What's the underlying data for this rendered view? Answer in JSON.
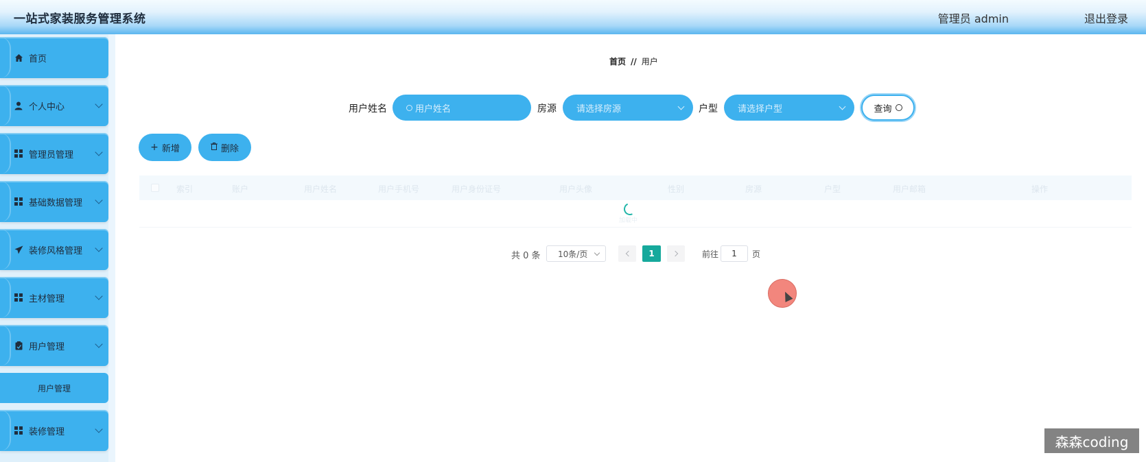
{
  "header": {
    "title": "一站式家装服务管理系统",
    "user": "管理员 admin",
    "logout": "退出登录"
  },
  "sidebar": {
    "items": [
      {
        "label": "首页",
        "icon": "home-icon"
      },
      {
        "label": "个人中心",
        "icon": "user-icon"
      },
      {
        "label": "管理员管理",
        "icon": "grid-icon"
      },
      {
        "label": "基础数据管理",
        "icon": "grid-icon"
      },
      {
        "label": "装修风格管理",
        "icon": "send-icon"
      },
      {
        "label": "主材管理",
        "icon": "grid-icon"
      },
      {
        "label": "用户管理",
        "icon": "clipboard-icon"
      },
      {
        "label": "装修管理",
        "icon": "grid-icon"
      }
    ],
    "submenu": {
      "label": "用户管理"
    }
  },
  "breadcrumb": {
    "home": "首页",
    "sep": "//",
    "current": "用户"
  },
  "search": {
    "name_label": "用户姓名",
    "name_placeholder": "用户姓名",
    "house_label": "房源",
    "house_placeholder": "请选择房源",
    "layout_label": "户型",
    "layout_placeholder": "请选择户型",
    "query_label": "查询"
  },
  "actions": {
    "add": "新增",
    "delete": "删除"
  },
  "table": {
    "columns": [
      "索引",
      "账户",
      "用户姓名",
      "用户手机号",
      "用户身份证号",
      "用户头像",
      "性别",
      "房源",
      "户型",
      "用户邮箱",
      "操作"
    ],
    "loading": "加载中"
  },
  "pagination": {
    "total": "共 0 条",
    "page_size": "10条/页",
    "current_page": "1",
    "goto_label": "前往",
    "goto_value": "1",
    "page_unit": "页"
  },
  "watermark": "森森coding",
  "colors": {
    "accent": "#3db1ee",
    "pager_active": "#16a99c",
    "sidebar_bg": "#dff0fb"
  }
}
